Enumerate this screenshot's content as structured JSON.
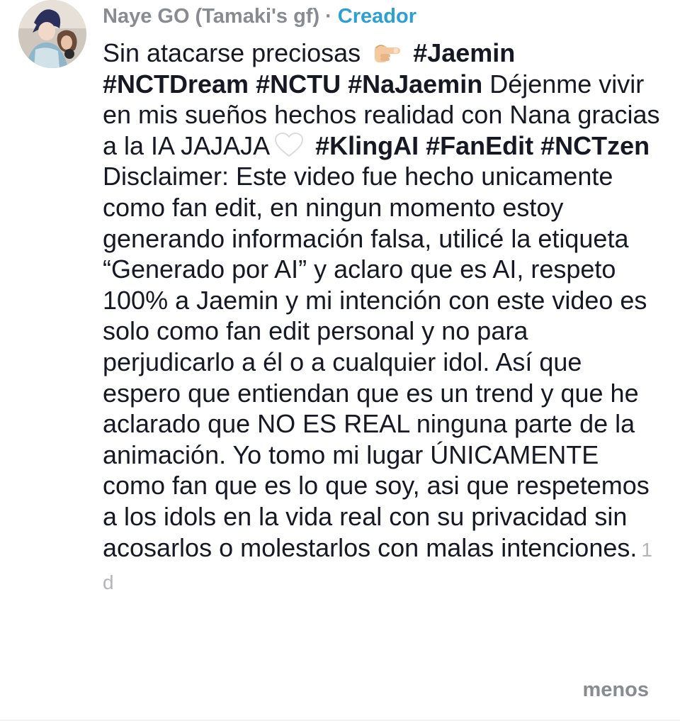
{
  "comment": {
    "username": "Naye GO (Tamaki's gf)",
    "separator": "·",
    "badge": "Creador",
    "segments": [
      {
        "text": "Sin atacarse preciosas ",
        "bold": false
      },
      {
        "emoji": "backhand-index-pointing-right"
      },
      {
        "text": " #Jaemin #NCTDream #NCTU #NaJaemin",
        "bold": true
      },
      {
        "text": " Déjenme vivir en mis sueños hechos realidad con Nana gracias a la IA JAJAJA",
        "bold": false
      },
      {
        "emoji": "white-heart"
      },
      {
        "text": " #KlingAI #FanEdit #NCTzen",
        "bold": true
      },
      {
        "text": " Disclaimer: Este video fue hecho unicamente como fan edit, en ningun momento estoy generando información falsa, utilicé la etiqueta “Generado por AI” y aclaro que es AI, respeto 100% a Jaemin y mi intención con este video es solo como fan edit personal y no para perjudicarlo a él o a cualquier idol. Así que espero que entiendan que es un trend y que he aclarado que NO ES REAL ninguna parte de la animación. Yo tomo mi lugar ÚNICAMENTE como fan que es lo que soy, asi que respetemos a los idols en la vida real con su privacidad sin acosarlos o molestarlos con malas intenciones.",
        "bold": false
      }
    ],
    "timestamp": "1 d",
    "less_label": "menos"
  },
  "colors": {
    "username": "#8a8b91",
    "creator_badge": "#2e9fd0",
    "body_text": "#161823",
    "timestamp": "#b5b5b8",
    "less_link": "#8a8b91"
  },
  "icons": {
    "emoji_1": "backhand-index-pointing-right",
    "emoji_2": "white-heart"
  }
}
